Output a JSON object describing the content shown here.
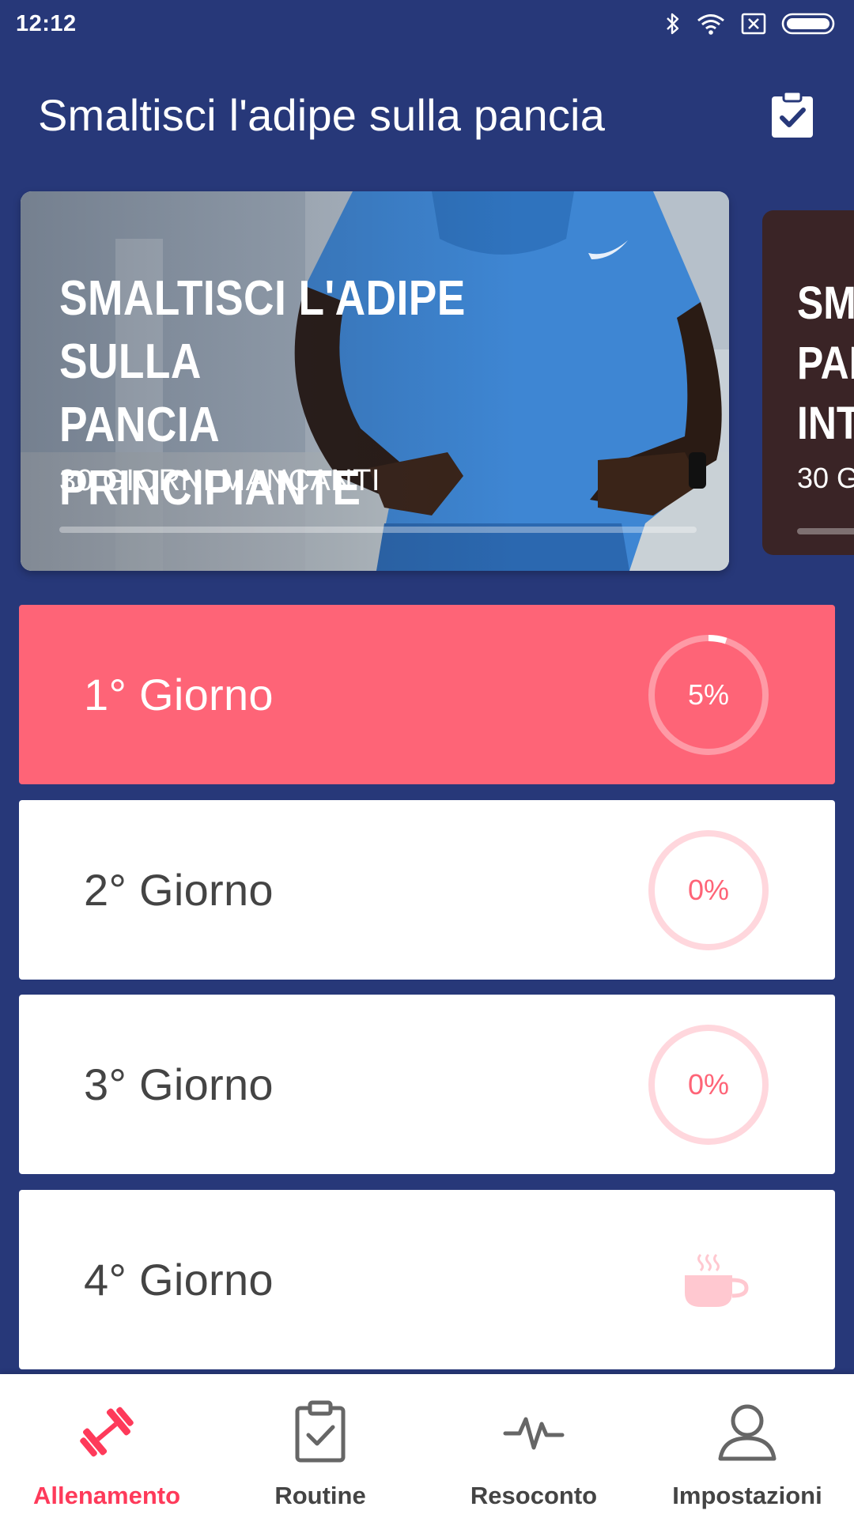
{
  "status_bar": {
    "time": "12:12",
    "icons": [
      "bluetooth-icon",
      "wifi-icon",
      "sim-off-icon",
      "battery-icon"
    ]
  },
  "app_bar": {
    "title": "Smaltisci l'adipe sulla pancia",
    "action_icon": "clipboard-check-icon"
  },
  "plans": [
    {
      "title_lines": [
        "SMALTISCI L'ADIPE SULLA",
        "PANCIA",
        "PRINCIPIANTE"
      ],
      "subtitle": "30 GIORNI MANCANTI",
      "progress": 0
    },
    {
      "title_lines": [
        "SM",
        "PAI",
        "INT"
      ],
      "subtitle": "30 G",
      "progress": 0
    }
  ],
  "days": [
    {
      "label": "1° Giorno",
      "progress_text": "5%",
      "progress": 0.05,
      "active": true
    },
    {
      "label": "2° Giorno",
      "progress_text": "0%",
      "progress": 0,
      "active": false
    },
    {
      "label": "3° Giorno",
      "progress_text": "0%",
      "progress": 0,
      "active": false
    },
    {
      "label": "4° Giorno",
      "rest_day": true,
      "icon": "coffee-cup-icon"
    }
  ],
  "bottom_nav": [
    {
      "label": "Allenamento",
      "icon": "dumbbell-icon",
      "active": true
    },
    {
      "label": "Routine",
      "icon": "clipboard-check-icon",
      "active": false
    },
    {
      "label": "Resoconto",
      "icon": "pulse-icon",
      "active": false
    },
    {
      "label": "Impostazioni",
      "icon": "person-icon",
      "active": false
    }
  ],
  "colors": {
    "background": "#273879",
    "accent": "#fe6477",
    "nav_active": "#fe3a5a",
    "ring_light": "#ffd7dd"
  }
}
